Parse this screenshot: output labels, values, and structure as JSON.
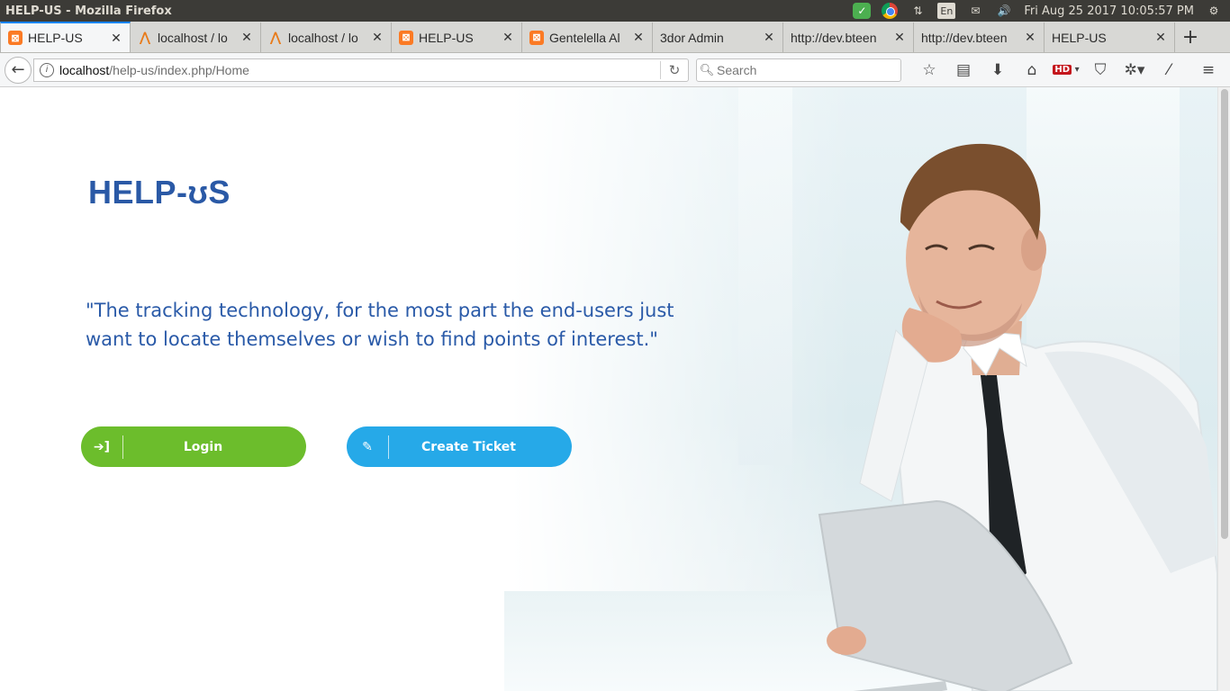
{
  "os": {
    "window_title": "HELP-US - Mozilla Firefox",
    "lang": "En",
    "clock": "Fri Aug 25 2017 10:05:57 PM"
  },
  "tabs": [
    {
      "label": "HELP-US",
      "icon": "xampp-icon",
      "active": true
    },
    {
      "label": "localhost / lo",
      "icon": "phpmyadmin-icon"
    },
    {
      "label": "localhost / lo",
      "icon": "phpmyadmin-icon"
    },
    {
      "label": "HELP-US",
      "icon": "xampp-icon"
    },
    {
      "label": "Gentelella Al",
      "icon": "xampp-icon"
    },
    {
      "label": "3dor Admin",
      "icon": ""
    },
    {
      "label": "http://dev.bteen",
      "icon": ""
    },
    {
      "label": "http://dev.bteen",
      "icon": ""
    },
    {
      "label": "HELP-US",
      "icon": ""
    }
  ],
  "nav": {
    "url_host": "localhost",
    "url_path": "/help-us/index.php/Home",
    "search_placeholder": "Search"
  },
  "page": {
    "logo": "HELP-ʊS",
    "quote": "\"The tracking technology, for the most part the end-users just want to locate themselves or wish to find points of interest.\"",
    "login_label": "Login",
    "ticket_label": "Create Ticket"
  },
  "colors": {
    "brand_blue": "#2a59a6",
    "login_green": "#6cbd2c",
    "ticket_blue": "#26a9e8"
  }
}
